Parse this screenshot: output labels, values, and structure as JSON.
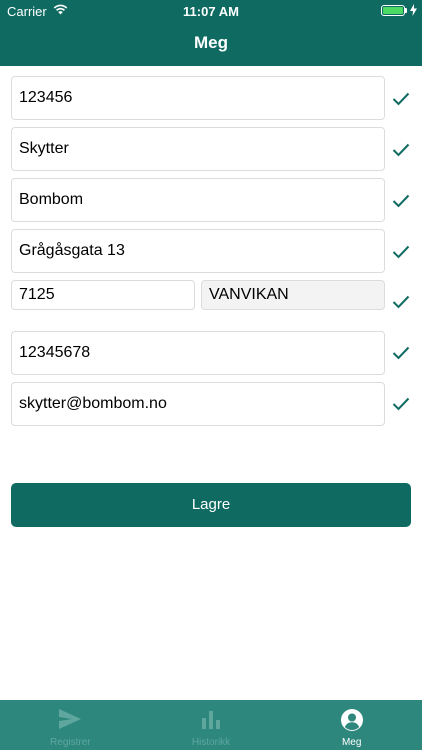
{
  "status": {
    "carrier": "Carrier",
    "time": "11:07 AM"
  },
  "header": {
    "title": "Meg"
  },
  "form": {
    "field1": "123456",
    "field2": "Skytter",
    "field3": "Bombom",
    "address": "Grågåsgata 13",
    "postal_code": "7125",
    "city": "VANVIKAN",
    "phone": "12345678",
    "email": "skytter@bombom.no"
  },
  "actions": {
    "save_label": "Lagre"
  },
  "tabs": [
    {
      "label": "Registrer",
      "icon": "send-icon"
    },
    {
      "label": "Historikk",
      "icon": "bar-chart-icon"
    },
    {
      "label": "Meg",
      "icon": "user-circle-icon"
    }
  ],
  "colors": {
    "primary": "#0f6b62",
    "tabbar": "#2d877c",
    "tab_inactive": "#5fa79e",
    "battery": "#4cd964"
  }
}
